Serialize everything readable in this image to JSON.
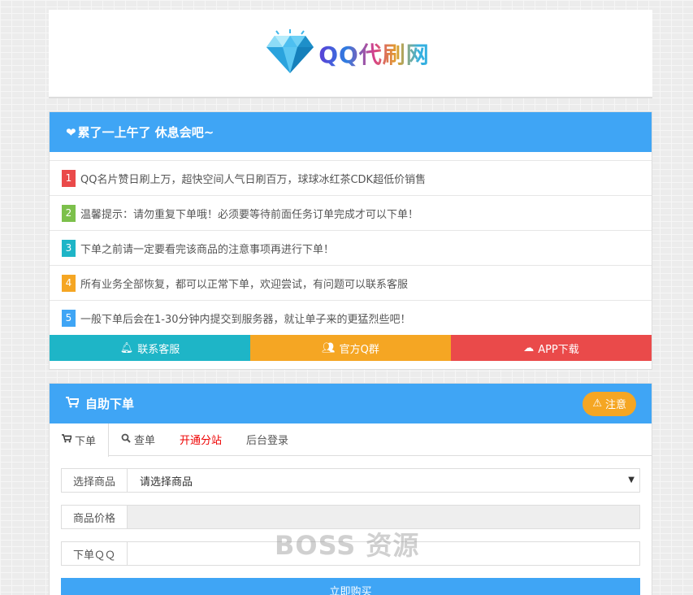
{
  "logo": {
    "text": "QQ代刷网",
    "icon": "diamond-icon"
  },
  "notice": {
    "heading": "累了一上午了 休息会吧~",
    "heading_icon": "heart-icon",
    "items": [
      {
        "num": "1",
        "color": "#ea4a4a",
        "text": "QQ名片赞日刷上万，超快空间人气日刷百万，球球冰红茶CDK超低价销售"
      },
      {
        "num": "2",
        "color": "#7cc04b",
        "text": "温馨提示：请勿重复下单哦！必须要等待前面任务订单完成才可以下单！"
      },
      {
        "num": "3",
        "color": "#1eb5c7",
        "text": "下单之前请一定要看完该商品的注意事项再进行下单！"
      },
      {
        "num": "4",
        "color": "#f5a623",
        "text": "所有业务全部恢复，都可以正常下单，欢迎尝试，有问题可以联系客服"
      },
      {
        "num": "5",
        "color": "#3fa5f5",
        "text": "一般下单后会在1-30分钟内提交到服务器，就让单子来的更猛烈些吧！"
      }
    ],
    "buttons": {
      "service": {
        "label": "联系客服",
        "color": "#1eb5c7",
        "icon": "bell-icon"
      },
      "qgroup": {
        "label": "官方Q群",
        "color": "#f5a623",
        "icon": "users-icon"
      },
      "app": {
        "label": "APP下载",
        "color": "#ea4a4a",
        "icon": "cloud-download-icon"
      }
    }
  },
  "order": {
    "heading": "自助下单",
    "heading_icon": "cart-icon",
    "warn_label": "注意",
    "tabs": {
      "order": "下单",
      "query": "查单",
      "open_site": "开通分站",
      "admin": "后台登录"
    },
    "form": {
      "product_label": "选择商品",
      "product_value": "请选择商品",
      "price_label": "商品价格",
      "price_value": "",
      "qq_label": "下单ＱＱ",
      "qq_value": ""
    },
    "submit_label": "立即购买"
  },
  "watermark": "BOSS 资源"
}
